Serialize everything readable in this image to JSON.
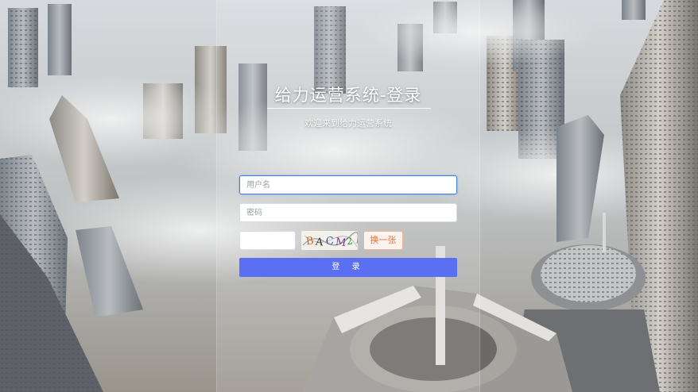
{
  "login": {
    "title": "给力运营系统-登录",
    "subtitle": "欢迎来到给力运营系统",
    "username_placeholder": "用户名",
    "password_placeholder": "密码",
    "captcha_placeholder": "",
    "captcha_text": "BACM2",
    "refresh_label": "换一张",
    "submit_label": "登 录"
  },
  "colors": {
    "accent": "#5a6ff2",
    "refresh_text": "#e8703d",
    "focus_border": "#3f7fe0"
  }
}
